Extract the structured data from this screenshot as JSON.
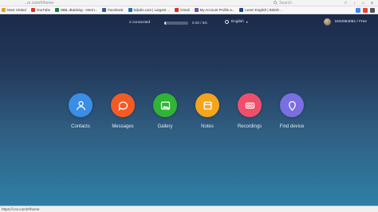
{
  "browser": {
    "url_fragment": "...m.com/#/home",
    "search_placeholder": "Search"
  },
  "bookmarks": [
    {
      "label": "Most Visited",
      "color": "#e0a020"
    },
    {
      "label": "YouTube",
      "color": "#e52d27"
    },
    {
      "label": "IBBL iBanking - Intern...",
      "color": "#1e7b3a"
    },
    {
      "label": "Facebook",
      "color": "#3b5998"
    },
    {
      "label": "bdjobs.com | Largest ...",
      "color": "#1f6fb5"
    },
    {
      "label": "Gmail",
      "color": "#d93025"
    },
    {
      "label": "My Account Profile a...",
      "color": "#7a4fb0"
    },
    {
      "label": "Learn English | British ...",
      "color": "#1a4c8b"
    }
  ],
  "topbar": {
    "connected": "2 connected",
    "storage_text": "0.02 / 5G",
    "storage_fraction": 0.08,
    "language": "English",
    "account": "1632964081 / Free"
  },
  "apps": [
    {
      "label": "Contacts",
      "color": "#3a8ee6",
      "icon": "person-icon"
    },
    {
      "label": "Messages",
      "color": "#f45b24",
      "icon": "chat-icon"
    },
    {
      "label": "Gallery",
      "color": "#31b336",
      "icon": "image-icon"
    },
    {
      "label": "Notes",
      "color": "#f4a51c",
      "icon": "note-icon"
    },
    {
      "label": "Recordings",
      "color": "#f04f6b",
      "icon": "recording-icon"
    },
    {
      "label": "Find device",
      "color": "#7a6fe0",
      "icon": "location-pin-icon"
    }
  ],
  "statusbar": {
    "url": "https://i.mi.com/#/home"
  }
}
